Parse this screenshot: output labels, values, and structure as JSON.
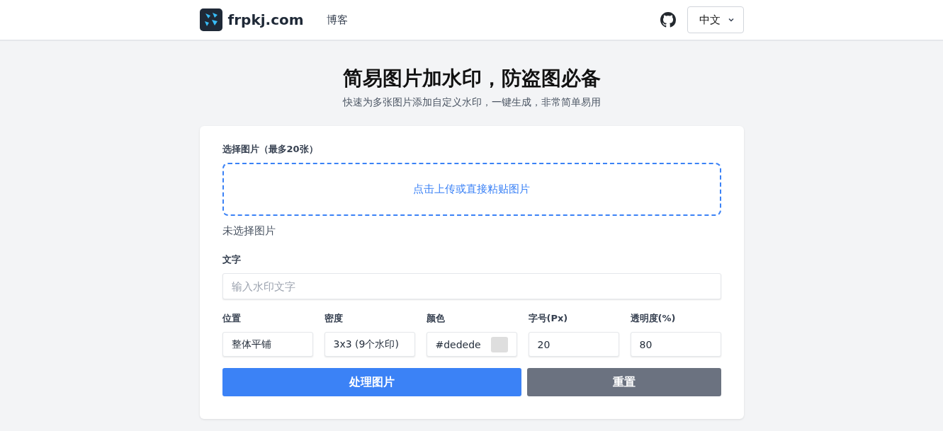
{
  "header": {
    "logo_text": "frpkj.com",
    "nav": [
      {
        "label": "博客"
      }
    ],
    "language": "中文"
  },
  "hero": {
    "title": "简易图片加水印，防盗图必备",
    "subtitle": "快速为多张图片添加自定义水印，一键生成，非常简单易用"
  },
  "upload": {
    "label": "选择图片（最多20张）",
    "dropzone_text": "点击上传或直接粘贴图片",
    "status": "未选择图片"
  },
  "text_field": {
    "label": "文字",
    "placeholder": "输入水印文字"
  },
  "options": [
    {
      "kind": "text",
      "label": "位置",
      "value": "整体平铺"
    },
    {
      "kind": "text",
      "label": "密度",
      "value": "3x3 (9个水印)"
    },
    {
      "kind": "color",
      "label": "颜色",
      "value": "#dedede"
    },
    {
      "kind": "text",
      "label": "字号(Px)",
      "value": "20"
    },
    {
      "kind": "text",
      "label": "透明度(%)",
      "value": "80"
    }
  ],
  "buttons": [
    {
      "kind": "primary",
      "label": "处理图片"
    },
    {
      "kind": "secondary",
      "label": "重置"
    }
  ]
}
